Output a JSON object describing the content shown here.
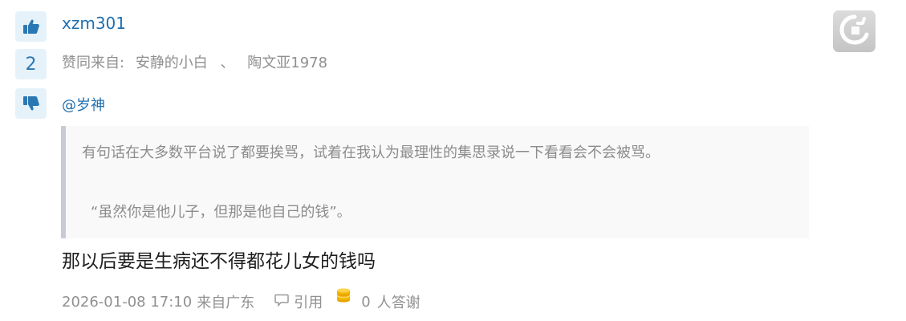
{
  "post": {
    "username": "xzm301",
    "vote_count": "2",
    "approvals": {
      "prefix": "赞同来自:",
      "users": [
        "安静的小白",
        "陶文亚1978"
      ],
      "separator": "、"
    },
    "mention": "@岁神",
    "quote": {
      "line1": "有句话在大多数平台说了都要挨骂，试着在我认为最理性的集思录说一下看看会不会被骂。",
      "line2": "“虽然你是他儿子，但那是他自己的钱”。"
    },
    "body": "那以后要是生病还不得都花儿女的钱吗",
    "meta": {
      "timestamp": "2026-01-08 17:10",
      "location": "来自广东",
      "quote_label": "引用",
      "thanks_count": "0",
      "thanks_label": "人答谢"
    }
  },
  "icons": {
    "vote_up": "thumbs-up-icon",
    "vote_down": "thumbs-down-icon",
    "quote": "speech-bubble-icon",
    "thanks": "coin-stack-icon",
    "avatar": "default-avatar-icon"
  },
  "colors": {
    "link": "#1f6fb0",
    "muted": "#909090",
    "vote_bg": "#e6f2fa",
    "quote_border": "#c6cbd4",
    "coin": "#f0b400"
  }
}
